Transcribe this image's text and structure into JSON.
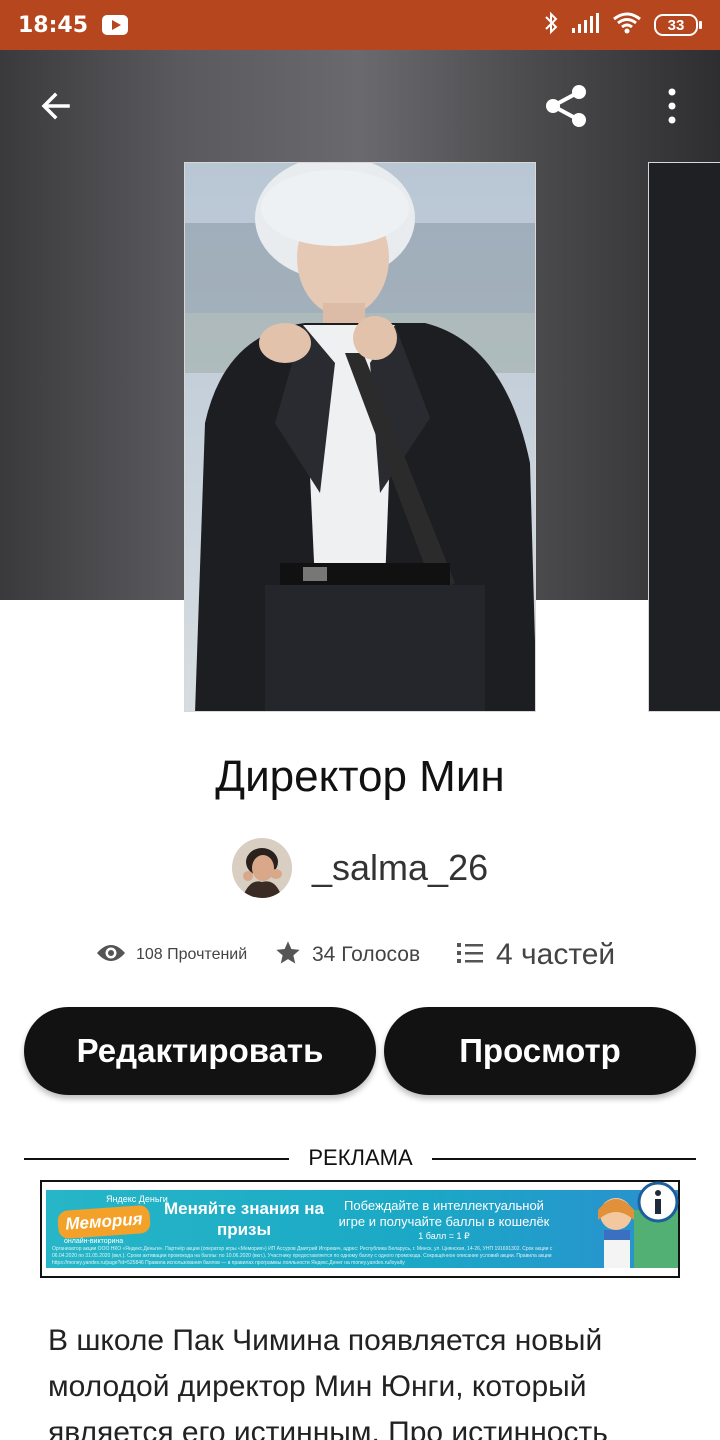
{
  "status_bar": {
    "time": "18:45",
    "battery": "33"
  },
  "story": {
    "title": "Директор Мин",
    "author": "_salma_26",
    "stats": {
      "reads": "108 Прочтений",
      "votes": "34 Голосов",
      "parts": "4 частей"
    },
    "description": "В школе Пак Чимина появляется новый молодой директор Мин Юнги, который является его истинным. Про истинность"
  },
  "actions": {
    "edit_label": "Редактировать",
    "view_label": "Просмотр"
  },
  "ad": {
    "label": "РЕКЛАМА",
    "brand_small": "Яндекс Деньги",
    "logo": "Мемория",
    "logo_sub": "онлайн-викторина",
    "headline": "Меняйте знания на призы",
    "body": "Побеждайте в интеллектуальной игре и получайте баллы в кошелёк",
    "points": "1 балл = 1 ₽",
    "fine_print": "Организатор акции ООО НКО «Яндекс.Деньги». Партнёр акции (оператор игры «Мемория») ИП Ассуров Дмитрий Игоревич, адрес: Республика Беларусь, г. Минск, ул. Цнянская, 14-26, УНП 191691302. Срок акции с 06.04.2020 по 31.05.2020 (вкл.). Сроки активации промокода на баллы: по 10.06.2020 (вкл.). Участнику предоставляется по одному баллу с одного промокода. Сокращённое описание условий акции. Правила акции https://money.yandex.ru/page?id=525846 Правила использования баллов — в правилах программы лояльности Яндекс.Денег на money.yandex.ru/loyalty"
  },
  "icons": {
    "back": "arrow-left-icon",
    "share": "share-icon",
    "more": "more-vertical-icon",
    "reads": "eye-icon",
    "votes": "star-icon",
    "parts": "list-icon",
    "ad_info": "info-icon"
  }
}
